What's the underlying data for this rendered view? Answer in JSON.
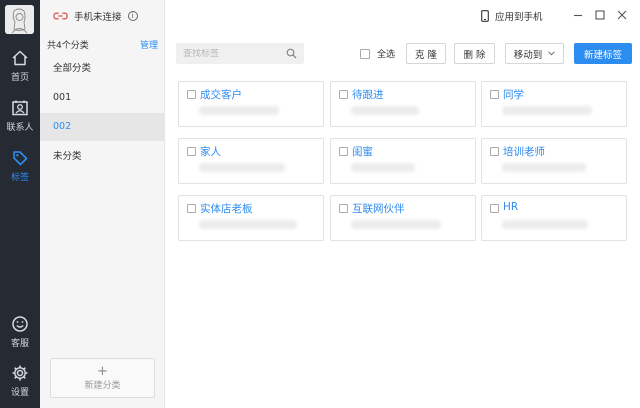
{
  "nav": {
    "items": [
      {
        "label": "首页",
        "icon": "home-icon"
      },
      {
        "label": "联系人",
        "icon": "contacts-icon"
      },
      {
        "label": "标签",
        "icon": "tag-icon",
        "active": true
      },
      {
        "label": "客服",
        "icon": "smiley-icon"
      },
      {
        "label": "设置",
        "icon": "gear-icon"
      }
    ]
  },
  "categories": {
    "count_label": "共4个分类",
    "manage_label": "管理",
    "items": [
      {
        "label": "全部分类"
      },
      {
        "label": "001"
      },
      {
        "label": "002",
        "active": true
      },
      {
        "label": "未分类"
      }
    ],
    "new_label": "新建分类",
    "new_plus": "+"
  },
  "topbar": {
    "connection_status": "手机未连接",
    "info_glyph": "i",
    "apply_label": "应用到手机"
  },
  "toolbar": {
    "search_placeholder": "查找标签",
    "select_all_label": "全选",
    "clone_label": "克 隆",
    "delete_label": "删 除",
    "move_label": "移动到",
    "new_tag_label": "新建标签"
  },
  "tags": [
    {
      "name": "成交客户"
    },
    {
      "name": "待跟进"
    },
    {
      "name": "同学"
    },
    {
      "name": "家人"
    },
    {
      "name": "闺蜜"
    },
    {
      "name": "培训老师"
    },
    {
      "name": "实体店老板"
    },
    {
      "name": "互联网伙伴"
    },
    {
      "name": "HR"
    }
  ],
  "colors": {
    "accent": "#2d8cf0",
    "nav_bg": "#262b33",
    "connection_icon": "#e05a5a"
  }
}
